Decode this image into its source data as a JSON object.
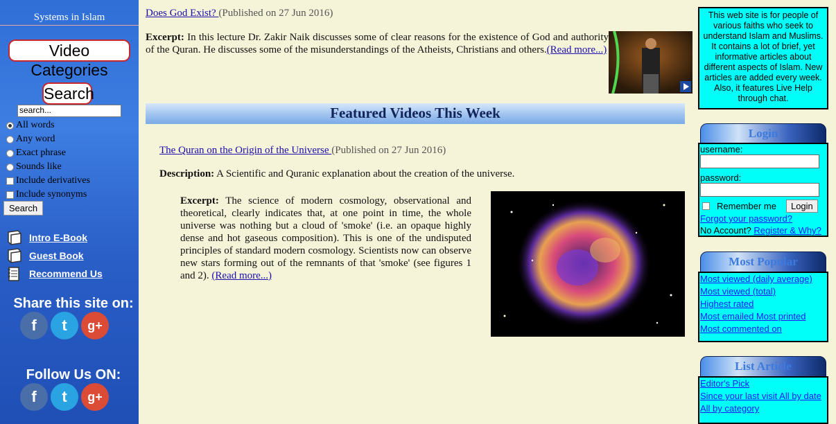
{
  "left": {
    "site_title": "Systems in Islam",
    "video_categories": "Video Categories",
    "search_title": "Search",
    "search_value": "search...",
    "options": [
      "All words",
      "Any word",
      "Exact phrase",
      "Sounds like"
    ],
    "checks": [
      "Include derivatives",
      "Include synonyms"
    ],
    "search_button": "Search",
    "links": [
      "Intro E-Book",
      "Guest Book",
      "Recommend Us"
    ],
    "share_title": "Share this site on:",
    "follow_title": "Follow Us ON:",
    "social": {
      "fb": "f",
      "tw": "t",
      "gp": "g+"
    }
  },
  "main": {
    "article1": {
      "title": "Does God Exist? ",
      "published": " (Published on 27 Jun 2016)",
      "excerpt_label": "Excerpt:",
      "excerpt": " In this lecture Dr. Zakir Naik discusses some of clear reasons for the existence of God and authority of the Quran. He discusses some of the misunderstandings of the Atheists, Christians and others.",
      "read_more": "(Read more...)"
    },
    "featured_heading": "Featured Videos This Week",
    "featured": {
      "title": "The Quran on the Origin of the Universe ",
      "published": " (Published on 27 Jun 2016)",
      "desc_label": "Description:",
      "desc": " A Scientific and Quranic explanation about the creation of the universe.",
      "excerpt_label": "Excerpt:",
      "excerpt": " The science of modern cosmology, observational and theoretical, clearly indicates that, at one point in time, the whole universe was nothing but a cloud of 'smoke' (i.e. an opaque highly dense and hot gaseous composition). This is one of the undisputed principles of standard modern cosmology. Scientists now can observe new stars forming out of the remnants of that 'smoke' (see figures 1 and 2). ",
      "read_more": "(Read more...)"
    }
  },
  "right": {
    "about_text": "This web site is for people of various faiths who seek to understand Islam and Muslims. It contains a lot of brief, yet informative articles about different aspects of Islam. New articles are added every week. Also, it features Live Help through chat.",
    "login_title": "Login",
    "username_label": "username:",
    "password_label": "password:",
    "remember": "Remember me",
    "login_button": "Login",
    "forgot": "Forgot your password?",
    "no_account": "No Account? ",
    "register": "Register & Why?",
    "popular_title": "Most Popular",
    "popular": [
      "Most viewed (daily average) ",
      "Most viewed (total) ",
      "Highest rated ",
      "Most emailed Most printed ",
      "Most commented on"
    ],
    "list_title": "List Article",
    "list": [
      "Editor's Pick ",
      "Since your last visit All by date",
      "All by category"
    ]
  }
}
